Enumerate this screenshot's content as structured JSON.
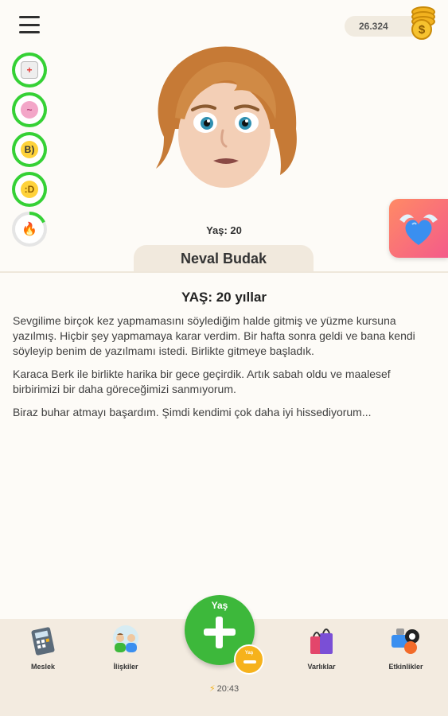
{
  "header": {
    "menu_icon": "hamburger-menu-icon",
    "coins": "26.324",
    "coin_icon": "coin-stack-icon",
    "coin_symbol": "$"
  },
  "stats": [
    {
      "name": "health",
      "icon": "health-kit-icon",
      "glyph": "+",
      "color": "#35d135",
      "level": 1.0
    },
    {
      "name": "smarts",
      "icon": "brain-icon",
      "glyph": "~",
      "color": "#35d135",
      "level": 1.0
    },
    {
      "name": "looks",
      "icon": "sunglasses-face-icon",
      "glyph": "B)",
      "color": "#35d135",
      "level": 1.0
    },
    {
      "name": "happiness",
      "icon": "smile-face-icon",
      "glyph": ":D",
      "color": "#35d135",
      "level": 1.0
    },
    {
      "name": "energy",
      "icon": "fire-icon",
      "glyph": "🔥",
      "color": "#35d135",
      "level": 0.18
    }
  ],
  "character": {
    "avatar_icon": "avatar-woman-icon",
    "age_small": "Yaş: 20",
    "name": "Neval Budak"
  },
  "love_button": {
    "icon": "winged-heart-icon"
  },
  "log": {
    "year_title": "YAŞ: 20 yıllar",
    "entries": [
      "Sevgilime birçok kez yapmamasını söylediğim halde gitmiş ve yüzme kursuna yazılmış. Hiçbir şey yapmamaya karar verdim. Bir hafta sonra geldi ve bana kendi söyleyip benim de yazılmamı istedi. Birlikte gitmeye başladık.",
      "Karaca Berk ile birlikte harika bir gece geçirdik. Artık sabah oldu ve maalesef birbirimizi bir daha göreceğimizi sanmıyorum.",
      "Biraz buhar atmayı başardım. Şimdi kendimi çok daha iyi hissediyorum..."
    ]
  },
  "nav": {
    "job": {
      "label": "Meslek",
      "icon": "calculator-icon"
    },
    "relations": {
      "label": "İlişkiler",
      "icon": "people-icon"
    },
    "age_button": {
      "label": "Yaş",
      "icon": "plus-icon"
    },
    "minus_button": {
      "label": "Yaş",
      "icon": "minus-icon"
    },
    "assets": {
      "label": "Varlıklar",
      "icon": "shopping-bags-icon"
    },
    "activities": {
      "label": "Etkinlikler",
      "icon": "activities-icon"
    },
    "energy_time": "20:43",
    "energy_icon": "lightning-bolt-icon"
  }
}
